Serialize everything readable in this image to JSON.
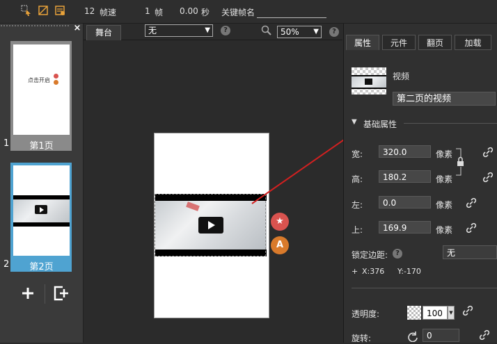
{
  "toolbar": {
    "fps_value": "12",
    "fps_label": "帧速",
    "frame_value": "1",
    "frame_label": "帧",
    "time_value": "0.00",
    "time_label": "秒",
    "keyframe_label": "关键帧名",
    "keyframe_value": ""
  },
  "pages": [
    {
      "number": "1",
      "label": "第1页",
      "thumb_text": "点击开启",
      "selected": false
    },
    {
      "number": "2",
      "label": "第2页",
      "selected": true
    }
  ],
  "stage": {
    "tab_label": "舞台",
    "transition_select": "无",
    "zoom_select": "50%"
  },
  "right_tabs": [
    "属性",
    "元件",
    "翻页",
    "加载"
  ],
  "properties": {
    "type_label": "视频",
    "name_value": "第二页的视频",
    "section_title": "基础属性",
    "width_label": "宽:",
    "width_value": "320.0",
    "height_label": "高:",
    "height_value": "180.2",
    "left_label": "左:",
    "left_value": "0.0",
    "top_label": "上:",
    "top_value": "169.9",
    "unit": "像素",
    "lock_margin_label": "锁定边距:",
    "lock_margin_value": "无",
    "coord_x": "X:376",
    "coord_y": "Y:-170",
    "opacity_label": "透明度:",
    "opacity_value": "100",
    "rotation_label": "旋转:",
    "rotation_value": "0"
  },
  "colors": {
    "accent": "#4fa3d1",
    "arrow": "#d42020",
    "star_button": "#d9534f",
    "text_button": "#d97a2b"
  }
}
